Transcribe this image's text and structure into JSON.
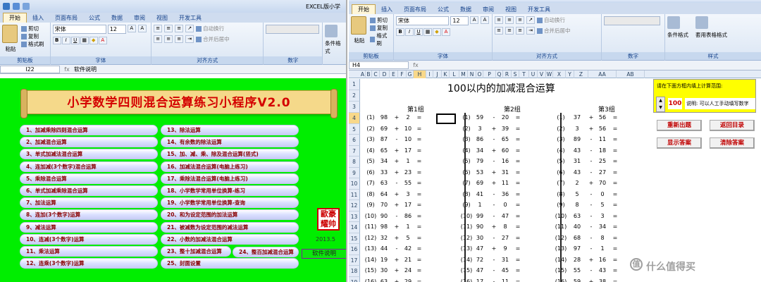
{
  "left_window": {
    "title": "EXCEL版小学",
    "tabs": [
      "开始",
      "插入",
      "页面布局",
      "公式",
      "数据",
      "审阅",
      "视图",
      "开发工具"
    ],
    "ribbon": {
      "paste": "粘贴",
      "cut": "剪切",
      "copy": "复制",
      "format_painter": "格式刷",
      "clipboard_label": "剪贴板",
      "font_name": "宋体",
      "font_size": "12",
      "font_label": "字体",
      "wrap": "自动换行",
      "merge": "合并后居中",
      "align_label": "对齐方式",
      "number_label": "数字",
      "cond_format": "条件格式"
    },
    "name_box": "I22",
    "formula": "软件说明",
    "program": {
      "title": "小学数学四则混合运算练习小程序V2.0",
      "col1": [
        "1、加减乘除四则混合运算",
        "2、加减混合运算",
        "3、单式加减法混合运算",
        "4、连加减(3个数字)混合运算",
        "5、乘除混合运算",
        "6、单式加减乘除混合运算",
        "7、加法运算",
        "8、连加(3个数字)运算",
        "9、减法运算",
        "10、连减(3个数字)运算",
        "11、乘法运算",
        "12、连乘(3个数字)运算"
      ],
      "col2": [
        "13、除法运算",
        "14、有余数的除法运算",
        "15、加、减、乘、除及混合运算(竖式)",
        "16、加减法混合运算(电脑上练习)",
        "17、乘除法混合运算(电脑上练习)",
        "18、小学数学常用单位换算-练习",
        "19、小学数学常用单位换算-查询",
        "20、和为设定范围的加法运算",
        "21、被减数为设定范围的减法运算",
        "22、小数的加减法混合运算",
        "23、整十加减混合运算",
        "25、封面设置"
      ],
      "btn24": "24、整百加减混合运算",
      "seal": "歐豪 耀帅",
      "date": "2013.5",
      "soft_button": "软件说明"
    }
  },
  "right_window": {
    "tabs": [
      "开始",
      "插入",
      "页面布局",
      "公式",
      "数据",
      "审阅",
      "视图",
      "开发工具"
    ],
    "ribbon": {
      "paste": "粘贴",
      "cut": "剪切",
      "copy": "复制",
      "format_painter": "格式刷",
      "clipboard_label": "剪贴板",
      "font_name": "宋体",
      "font_size": "12",
      "font_label": "字体",
      "wrap": "自动换行",
      "merge": "合并后居中",
      "align_label": "对齐方式",
      "number_label": "数字",
      "cond_format": "条件格式",
      "table_format": "套用表格格式",
      "style_label": "样式"
    },
    "name_box": "H4",
    "columns": [
      "A",
      "B",
      "C",
      "D",
      "E",
      "F",
      "G",
      "H",
      "I",
      "J",
      "K",
      "L",
      "M",
      "N",
      "O",
      "P",
      "Q",
      "R",
      "S",
      "T",
      "U",
      "V",
      "W",
      "X",
      "Y",
      "Z",
      "AA",
      "AB"
    ],
    "rows": [
      "1",
      "2",
      "3",
      "4",
      "5",
      "6",
      "7",
      "8",
      "9",
      "10",
      "11",
      "12",
      "13",
      "14",
      "15",
      "16",
      "17",
      "18",
      "19"
    ],
    "sheet_title": "100以内的加减混合运算",
    "group_titles": [
      "第1组",
      "第2组",
      "第3组"
    ],
    "groups": [
      [
        [
          "(1)",
          "98",
          "+",
          "2",
          "="
        ],
        [
          "(2)",
          "69",
          "+",
          "10",
          "="
        ],
        [
          "(3)",
          "87",
          "-",
          "10",
          "="
        ],
        [
          "(4)",
          "65",
          "+",
          "17",
          "="
        ],
        [
          "(5)",
          "34",
          "+",
          "1",
          "="
        ],
        [
          "(6)",
          "33",
          "+",
          "23",
          "="
        ],
        [
          "(7)",
          "63",
          "-",
          "55",
          "="
        ],
        [
          "(8)",
          "64",
          "+",
          "3",
          "="
        ],
        [
          "(9)",
          "70",
          "+",
          "17",
          "="
        ],
        [
          "(10)",
          "90",
          "-",
          "86",
          "="
        ],
        [
          "(11)",
          "98",
          "+",
          "1",
          "="
        ],
        [
          "(12)",
          "32",
          "+",
          "5",
          "="
        ],
        [
          "(13)",
          "44",
          "-",
          "42",
          "="
        ],
        [
          "(14)",
          "19",
          "+",
          "21",
          "="
        ],
        [
          "(15)",
          "30",
          "+",
          "24",
          "="
        ],
        [
          "(16)",
          "63",
          "+",
          "29",
          "="
        ]
      ],
      [
        [
          "(1)",
          "59",
          "-",
          "20",
          "="
        ],
        [
          "(2)",
          "3",
          "+",
          "39",
          "="
        ],
        [
          "(3)",
          "86",
          "-",
          "65",
          "="
        ],
        [
          "(4)",
          "34",
          "+",
          "60",
          "="
        ],
        [
          "(5)",
          "79",
          "-",
          "16",
          "="
        ],
        [
          "(6)",
          "53",
          "+",
          "31",
          "="
        ],
        [
          "(7)",
          "69",
          "+",
          "11",
          "="
        ],
        [
          "(8)",
          "41",
          "-",
          "36",
          "="
        ],
        [
          "(9)",
          "1",
          "-",
          "0",
          "="
        ],
        [
          "(10)",
          "99",
          "-",
          "47",
          "="
        ],
        [
          "(11)",
          "90",
          "+",
          "8",
          "="
        ],
        [
          "(12)",
          "30",
          "-",
          "27",
          "="
        ],
        [
          "(13)",
          "47",
          "+",
          "9",
          "="
        ],
        [
          "(14)",
          "72",
          "-",
          "31",
          "="
        ],
        [
          "(15)",
          "47",
          "-",
          "45",
          "="
        ],
        [
          "(16)",
          "17",
          "-",
          "11",
          "="
        ]
      ],
      [
        [
          "(1)",
          "37",
          "+",
          "56",
          "="
        ],
        [
          "(2)",
          "3",
          "+",
          "56",
          "="
        ],
        [
          "(3)",
          "89",
          "-",
          "11",
          "="
        ],
        [
          "(4)",
          "43",
          "-",
          "18",
          "="
        ],
        [
          "(5)",
          "31",
          "-",
          "25",
          "="
        ],
        [
          "(6)",
          "43",
          "-",
          "27",
          "="
        ],
        [
          "(7)",
          "2",
          "+",
          "70",
          "="
        ],
        [
          "(8)",
          "5",
          "-",
          "0",
          "="
        ],
        [
          "(9)",
          "8",
          "-",
          "5",
          "="
        ],
        [
          "(10)",
          "63",
          "-",
          "3",
          "="
        ],
        [
          "(11)",
          "40",
          "-",
          "34",
          "="
        ],
        [
          "(12)",
          "68",
          "-",
          "8",
          "="
        ],
        [
          "(13)",
          "97",
          "-",
          "1",
          "="
        ],
        [
          "(14)",
          "28",
          "+",
          "16",
          "="
        ],
        [
          "(15)",
          "55",
          "-",
          "43",
          "="
        ],
        [
          "(16)",
          "59",
          "+",
          "38",
          "="
        ]
      ]
    ],
    "panel": {
      "hint": "请在下面方框内填上计算范围:",
      "range_value": "100",
      "range_desc": "说明: 可以人工手动填写数字"
    },
    "buttons": [
      "重新出题",
      "返回目录",
      "显示答案",
      "清除答案"
    ]
  },
  "watermark": "什么值得买",
  "watermark_icon": "值"
}
